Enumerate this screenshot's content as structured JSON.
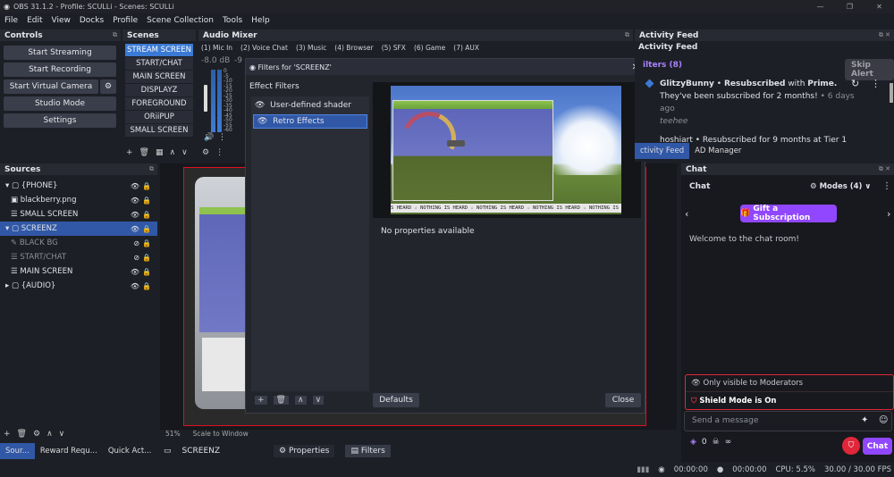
{
  "window": {
    "title": "OBS 31.1.2 - Profile: SCULLi - Scenes: SCULLi"
  },
  "menu": [
    "File",
    "Edit",
    "View",
    "Docks",
    "Profile",
    "Scene Collection",
    "Tools",
    "Help"
  ],
  "controls": {
    "title": "Controls",
    "buttons": [
      "Start Streaming",
      "Start Recording",
      "Start Virtual Camera",
      "Studio Mode",
      "Settings"
    ]
  },
  "scenes": {
    "title": "Scenes",
    "items": [
      "STREAM SCREEN",
      "START/CHAT",
      "MAIN SCREEN",
      "DISPLAYZ",
      "FOREGROUND",
      "ORiiPUP",
      "SMALL SCREEN"
    ],
    "selected": "STREAM SCREEN"
  },
  "audio_mixer": {
    "title": "Audio Mixer",
    "tabs": [
      "(1) Mic In",
      "(2) Voice Chat",
      "(3) Music",
      "(4) Browser",
      "(5) SFX",
      "(6) Game",
      "(7) AUX"
    ],
    "db_value": "-8.0 dB",
    "db_value2": "-9",
    "scale": [
      "0",
      "-5",
      "-10",
      "-15",
      "-20",
      "-25",
      "-30",
      "-35",
      "-40",
      "-45",
      "-50",
      "-55",
      "-60"
    ]
  },
  "sources": {
    "title": "Sources",
    "items": [
      {
        "label": "{PHONE}",
        "prefix": "▾ ▢"
      },
      {
        "label": "blackberry.png",
        "prefix": "▣"
      },
      {
        "label": "SMALL SCREEN",
        "prefix": "☰"
      },
      {
        "label": "SCREENZ",
        "prefix": "▾ ▢"
      },
      {
        "label": "BLACK BG",
        "prefix": "✎"
      },
      {
        "label": "START/CHAT",
        "prefix": "☰"
      },
      {
        "label": "MAIN SCREEN",
        "prefix": "☰"
      },
      {
        "label": "{AUDIO}",
        "prefix": "▸ ▢"
      }
    ]
  },
  "bottom_tabs": [
    "Sour...",
    "Reward Requ...",
    "Quick Act..."
  ],
  "preview": {
    "zoom": "51%",
    "scale_mode": "Scale to Window",
    "selected_source": "SCREENZ",
    "properties_btn": "Properties",
    "filters_btn": "Filters"
  },
  "filters_dialog": {
    "title": "Filters for 'SCREENZ'",
    "section": "Effect Filters",
    "filters": [
      "User-defined shader",
      "Retro Effects"
    ],
    "selected": "Retro Effects",
    "no_props": "No properties available",
    "defaults_btn": "Defaults",
    "close_btn": "Close",
    "ticker": "S HEARD ☆ NOTHING IS HEARD ☆ NOTHING IS HEARD ☆ NOTHING IS HEARD ☆ NOTHING IS HEARD"
  },
  "activity_feed": {
    "title": "Activity Feed",
    "subtitle": "Activity Feed",
    "filters_label": "ilters (8)",
    "skip_alert": "Skip Alert",
    "entry": {
      "user": "GlitzyBunny",
      "sep": "•",
      "action": "Resubscribed",
      "with": "with",
      "tier": "Prime.",
      "message": "They've been subscribed for 2 months!",
      "time": "• 6 days ago",
      "note": "teehee"
    },
    "entry2": "hoshiart • Resubscribed for 9 months at Tier 1"
  },
  "dock_tabs": [
    "ctivity Feed",
    "AD Manager"
  ],
  "chat": {
    "title": "Chat",
    "header": "Chat",
    "modes": "Modes (4)",
    "gift_btn": "Gift a Subscription",
    "welcome": "Welcome to the chat room!",
    "mod_notice": "Only visible to Moderators",
    "shield_notice": "Shield Mode is On",
    "placeholder": "Send a message",
    "points": "0",
    "infinity": "∞",
    "chat_btn": "Chat"
  },
  "status": {
    "stream_time": "00:00:00",
    "rec_time": "00:00:00",
    "cpu": "CPU: 5.5%",
    "fps": "30.00 / 30.00 FPS"
  },
  "colors": {
    "accent": "#3a7ad4",
    "twitch_purple": "#9147ff",
    "shield_red": "#e0273a",
    "selection": "#3158a6"
  }
}
